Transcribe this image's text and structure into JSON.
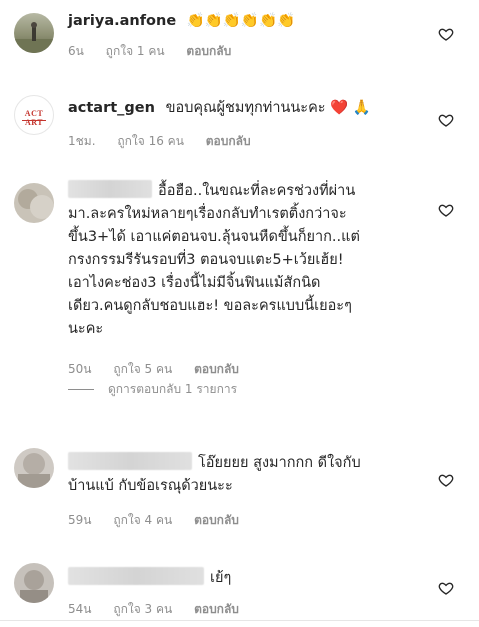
{
  "comments": [
    {
      "username": "jariya.anfone",
      "text": "👏👏👏👏👏👏",
      "time": "6น",
      "likes": "ถูกใจ 1 คน",
      "reply": "ตอบกลับ"
    },
    {
      "username": "actart_gen",
      "text": "ขอบคุณผู้ชมทุกท่านนะคะ ❤️ 🙏",
      "avatar_text": "ACT ART",
      "time": "1ชม.",
      "likes": "ถูกใจ 16 คน",
      "reply": "ตอบกลับ"
    },
    {
      "username": "",
      "text_lines": [
        "อื้อฮือ..ในขณะที่ละครช่วงที่ผ่าน",
        "มา.ละครใหม่หลายๆเรื่องกลับทำเรตติ้งกว่าจะ",
        "ขึ้น3+ได้ เอาแค่ตอนจบ.ลุ้นจนหืดขึ้นก็ยาก..แต่",
        "กรงกรรมรีรันรอบที่3 ตอนจบแตะ5+เว้ยเฮ้ย!",
        "เอาไงคะช่อง3 เรื่องนี้ไม่มีจิ้นฟินแม้สักนิด",
        "เดียว.คนดูกลับชอบแฮะ! ขอละครแบบนี้เยอะๆ",
        "นะคะ"
      ],
      "time": "50น",
      "likes": "ถูกใจ 5 คน",
      "reply": "ตอบกลับ"
    },
    {
      "username": "",
      "text_lines": [
        "โอ๊ยยยย สูงมากกก ดีใจกับ",
        "บ้านแบ้ กับข้อเรณุด้วยนะะ"
      ],
      "time": "59น",
      "likes": "ถูกใจ 4 คน",
      "reply": "ตอบกลับ"
    },
    {
      "username": "",
      "text": "เย้ๆ",
      "time": "54น",
      "likes": "ถูกใจ 3 คน",
      "reply": "ตอบกลับ"
    }
  ],
  "view_replies": "ดูการตอบกลับ 1 รายการ",
  "colors": {
    "text": "#262626",
    "meta": "#8e8e8e",
    "heart_red": "#e0245e"
  },
  "icons": {
    "like": "heart-outline-icon"
  }
}
